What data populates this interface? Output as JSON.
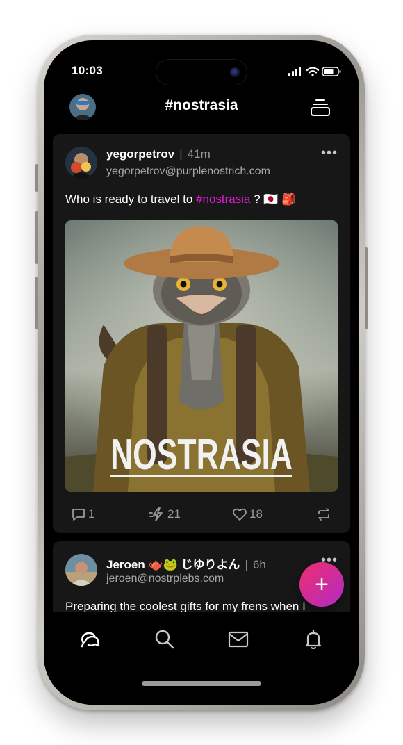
{
  "status_bar": {
    "time": "10:03"
  },
  "header": {
    "title": "#nostrasia",
    "avatar_icon": "user-avatar",
    "menu_icon": "feeds-stack-icon"
  },
  "posts": [
    {
      "username": "yegorpetrov",
      "separator": "|",
      "time_ago": "41m",
      "nip05": "yegorpetrov@purplenostrich.com",
      "content_prefix": "Who is ready to travel to ",
      "hashtag": "#nostrasia",
      "content_suffix": " ? 🇯🇵 🎒",
      "image_caption": "NOSTRASIA",
      "more_label": "•••",
      "actions": {
        "replies": "1",
        "zaps": "21",
        "likes": "18"
      }
    },
    {
      "username": "Jeroen 🫖🐸 じゆりよん",
      "separator": "|",
      "time_ago": "6h",
      "nip05": "jeroen@nostrplebs.com",
      "content": "Preparing the coolest gifts for my frens when I",
      "more_label": "•••"
    }
  ],
  "fab": {
    "label": "+"
  },
  "bottom_nav": [
    {
      "name": "home",
      "icon": "home-chat-icon",
      "active": true
    },
    {
      "name": "search",
      "icon": "search-icon",
      "active": false
    },
    {
      "name": "messages",
      "icon": "mail-icon",
      "active": false
    },
    {
      "name": "notifications",
      "icon": "bell-icon",
      "active": false
    }
  ],
  "colors": {
    "accent": "#e619d5",
    "fab_start": "#ef2e6d",
    "fab_end": "#b12ac4",
    "card_bg": "#171717"
  }
}
